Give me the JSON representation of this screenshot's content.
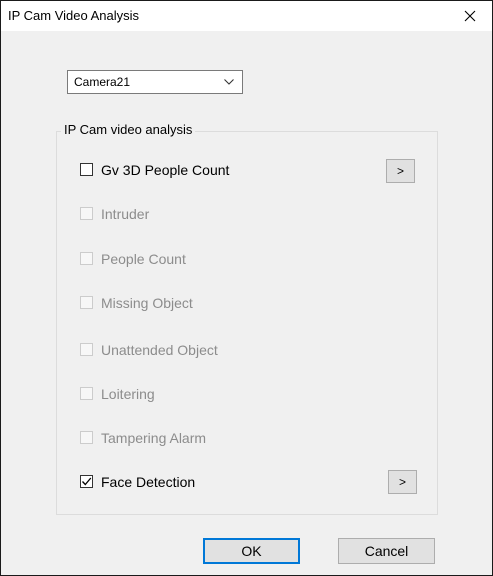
{
  "window": {
    "title": "IP Cam Video Analysis"
  },
  "camera_select": {
    "value": "Camera21"
  },
  "group": {
    "label": "IP Cam video analysis",
    "items": [
      {
        "label": "Gv 3D People Count",
        "checked": false,
        "enabled": true,
        "has_more": true
      },
      {
        "label": "Intruder",
        "checked": false,
        "enabled": false
      },
      {
        "label": "People Count",
        "checked": false,
        "enabled": false
      },
      {
        "label": "Missing Object",
        "checked": false,
        "enabled": false
      },
      {
        "label": "Unattended Object",
        "checked": false,
        "enabled": false
      },
      {
        "label": "Loitering",
        "checked": false,
        "enabled": false
      },
      {
        "label": "Tampering Alarm",
        "checked": false,
        "enabled": false
      },
      {
        "label": "Face Detection",
        "checked": true,
        "enabled": true,
        "has_more": true
      }
    ],
    "more_button_label": ">"
  },
  "buttons": {
    "ok": "OK",
    "cancel": "Cancel"
  },
  "colors": {
    "default_button_border": "#0078d7",
    "disabled_text": "#8c8c8c"
  },
  "icons": {
    "close": "close-icon",
    "dropdown": "chevron-down-icon",
    "check": "checkmark-icon"
  }
}
